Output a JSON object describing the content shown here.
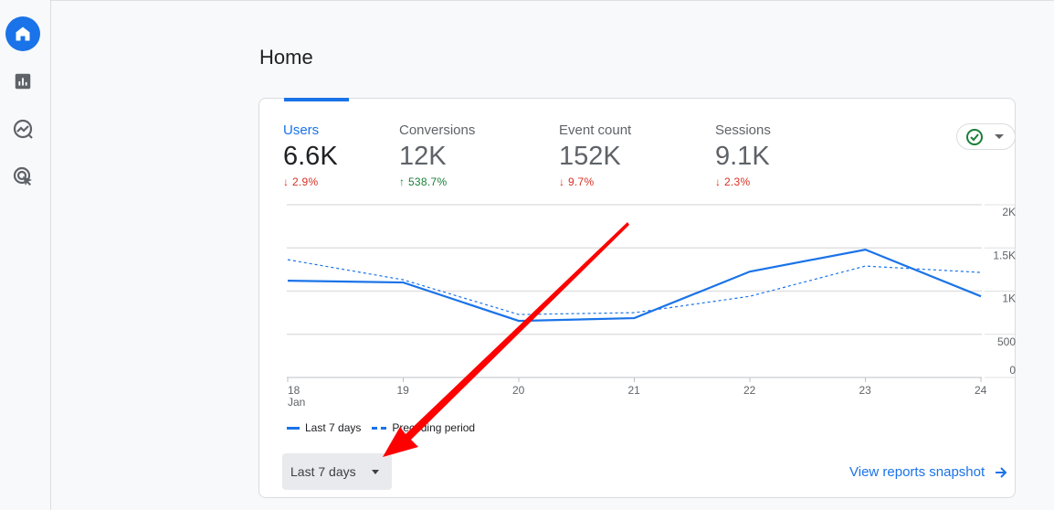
{
  "sidebar": {
    "items": [
      {
        "icon": "home-icon",
        "active": true
      },
      {
        "icon": "reports-icon"
      },
      {
        "icon": "explore-icon"
      },
      {
        "icon": "advertising-icon"
      }
    ]
  },
  "page": {
    "title": "Home"
  },
  "metrics": [
    {
      "label": "Users",
      "value": "6.6K",
      "change": "2.9%",
      "direction": "down",
      "active": true
    },
    {
      "label": "Conversions",
      "value": "12K",
      "change": "538.7%",
      "direction": "up"
    },
    {
      "label": "Event count",
      "value": "152K",
      "change": "9.7%",
      "direction": "down"
    },
    {
      "label": "Sessions",
      "value": "9.1K",
      "change": "2.3%",
      "direction": "down"
    }
  ],
  "arrows": {
    "down": "↓",
    "up": "↑"
  },
  "colors": {
    "accent": "#1a73e8",
    "down": "#d93025",
    "up": "#188038",
    "annotation": "#ff0000"
  },
  "chart_data": {
    "type": "line",
    "categories": [
      "18",
      "19",
      "20",
      "21",
      "22",
      "23",
      "24"
    ],
    "x_month_label": "Jan",
    "ylim": [
      0,
      2000
    ],
    "yticks": [
      0,
      500,
      1000,
      1500,
      2000
    ],
    "ytick_labels": [
      "0",
      "500",
      "1K",
      "1.5K",
      "2K"
    ],
    "grid": true,
    "legend": "bottom-left",
    "series": [
      {
        "name": "Last 7 days",
        "style": "solid",
        "values": [
          1120,
          1100,
          655,
          687,
          1226,
          1480,
          940
        ]
      },
      {
        "name": "Preceding period",
        "style": "dashed",
        "values": [
          1364,
          1131,
          729,
          750,
          940,
          1290,
          1216
        ]
      }
    ]
  },
  "date_range": {
    "label": "Last 7 days"
  },
  "view_link": {
    "label": "View reports snapshot",
    "icon": "arrow-right-icon"
  },
  "status_button": {
    "icon": "check-circle-icon"
  }
}
